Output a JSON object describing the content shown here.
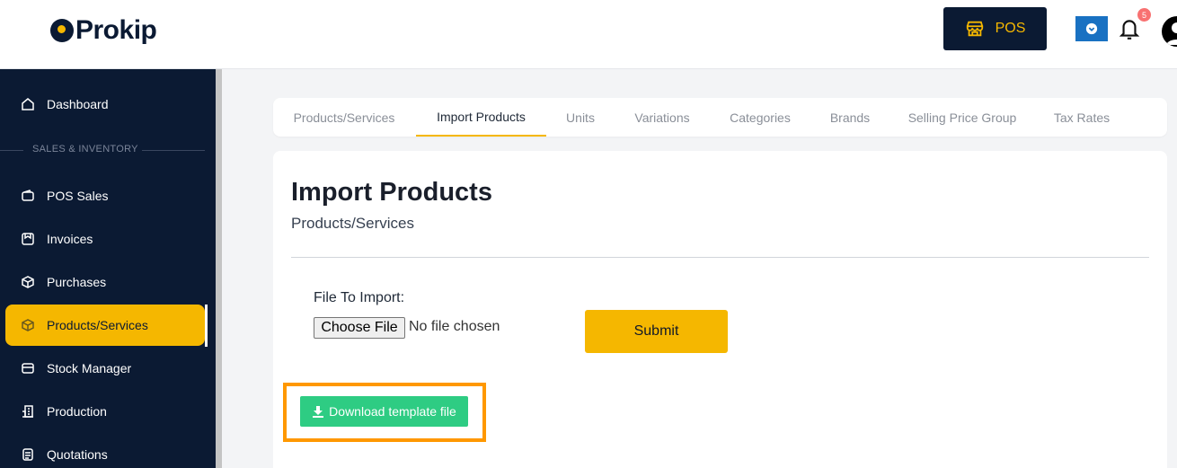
{
  "brand": {
    "name": "Prokip"
  },
  "header": {
    "pos_label": "POS",
    "notification_count": "5",
    "colors": {
      "navy": "#0b1a33",
      "accent": "#f5b700",
      "download_app": "#1971c2",
      "badge": "#f87171"
    }
  },
  "sidebar": {
    "dashboard": {
      "label": "Dashboard",
      "icon": "home-icon"
    },
    "section_title": "SALES & INVENTORY",
    "items": [
      {
        "label": "POS Sales",
        "icon": "wallet-icon"
      },
      {
        "label": "Invoices",
        "icon": "invoice-icon"
      },
      {
        "label": "Purchases",
        "icon": "box-add-icon"
      },
      {
        "label": "Products/Services",
        "icon": "package-icon",
        "active": true
      },
      {
        "label": "Stock Manager",
        "icon": "stock-icon"
      },
      {
        "label": "Production",
        "icon": "building-icon"
      },
      {
        "label": "Quotations",
        "icon": "document-icon"
      }
    ]
  },
  "tabs": [
    {
      "label": "Products/Services"
    },
    {
      "label": "Import Products",
      "active": true
    },
    {
      "label": "Units"
    },
    {
      "label": "Variations"
    },
    {
      "label": "Categories"
    },
    {
      "label": "Brands"
    },
    {
      "label": "Selling Price Group"
    },
    {
      "label": "Tax Rates"
    }
  ],
  "page": {
    "title": "Import Products",
    "subtitle": "Products/Services",
    "file_label": "File To Import:",
    "choose_file_label": "Choose File",
    "no_file_text": "No file chosen",
    "submit_label": "Submit",
    "download_label": "Download template file",
    "colors": {
      "download_button": "#2ecc83",
      "highlight": "#ff9800"
    }
  }
}
